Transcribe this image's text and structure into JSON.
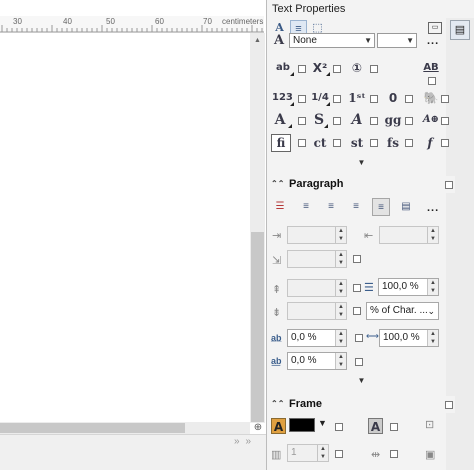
{
  "ruler": {
    "ticks": [
      "30",
      "40",
      "50",
      "60",
      "70"
    ],
    "unit_label": "centimeters"
  },
  "sidebar": {
    "title": "Text Properties",
    "font_name": "None",
    "font_size": "",
    "dots": "...",
    "paragraph": {
      "title": "Paragraph",
      "line_spacing": "100,0 %",
      "spacing_mode": "% of Char. ...",
      "char_spacing": "0,0 %",
      "word_spacing": "100,0 %",
      "language_spacing": "0,0 %"
    },
    "frame": {
      "title": "Frame",
      "columns": "1"
    }
  },
  "icons": {
    "text-frame": "text-frame-icon",
    "paragraph": "paragraph-icon",
    "frame": "frame-icon"
  }
}
